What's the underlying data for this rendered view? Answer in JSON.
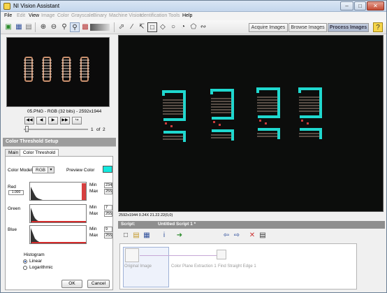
{
  "window": {
    "title": "NI Vision Assistant"
  },
  "menus": [
    {
      "label": "File",
      "enabled": true
    },
    {
      "label": "Edit",
      "enabled": false
    },
    {
      "label": "View",
      "enabled": true
    },
    {
      "label": "Image",
      "enabled": false
    },
    {
      "label": "Color",
      "enabled": false
    },
    {
      "label": "Grayscale",
      "enabled": false
    },
    {
      "label": "Binary",
      "enabled": false
    },
    {
      "label": "Machine Vision",
      "enabled": false
    },
    {
      "label": "Identification",
      "enabled": false
    },
    {
      "label": "Tools",
      "enabled": false
    },
    {
      "label": "Help",
      "enabled": true
    }
  ],
  "modes": {
    "acquire": "Acquire Images",
    "browse": "Browse Images",
    "process": "Process Images"
  },
  "browser": {
    "image_info": "05.PNG - RGB (32 bits) - 2592x1944",
    "page_current": "1",
    "page_of": "of",
    "page_total": "2"
  },
  "setup": {
    "header": "Color Threshold Setup",
    "tab_main": "Main",
    "tab_color_threshold": "Color Threshold",
    "color_model_label": "Color Model",
    "color_model_value": "RGB",
    "preview_color_label": "Preview Color",
    "preview_color": "#12e8de",
    "zoom_value": "1.000",
    "channels": [
      {
        "name": "Red",
        "min_label": "Min",
        "min": "234",
        "max_label": "Max",
        "max": "255",
        "color": "#d32b2b"
      },
      {
        "name": "Green",
        "min_label": "Min",
        "min": "7",
        "max_label": "Max",
        "max": "255",
        "color": "#d32b2b"
      },
      {
        "name": "Blue",
        "min_label": "Min",
        "min": "9",
        "max_label": "Max",
        "max": "255",
        "color": "#d32b2b"
      }
    ],
    "histogram_label": "Histogram",
    "histogram_options": [
      "Linear",
      "Logarithmic"
    ],
    "histogram_selected": "Linear",
    "ok": "OK",
    "cancel": "Cancel"
  },
  "viewer": {
    "status": "2592x1944 0.24X 21.22.22",
    "coords": "(0,0)"
  },
  "script": {
    "label": "Script:",
    "title": "Untitled Script 1 *",
    "steps": [
      "Original Image",
      "Color Plane Extraction 1",
      "Find Straight Edge 1"
    ]
  }
}
